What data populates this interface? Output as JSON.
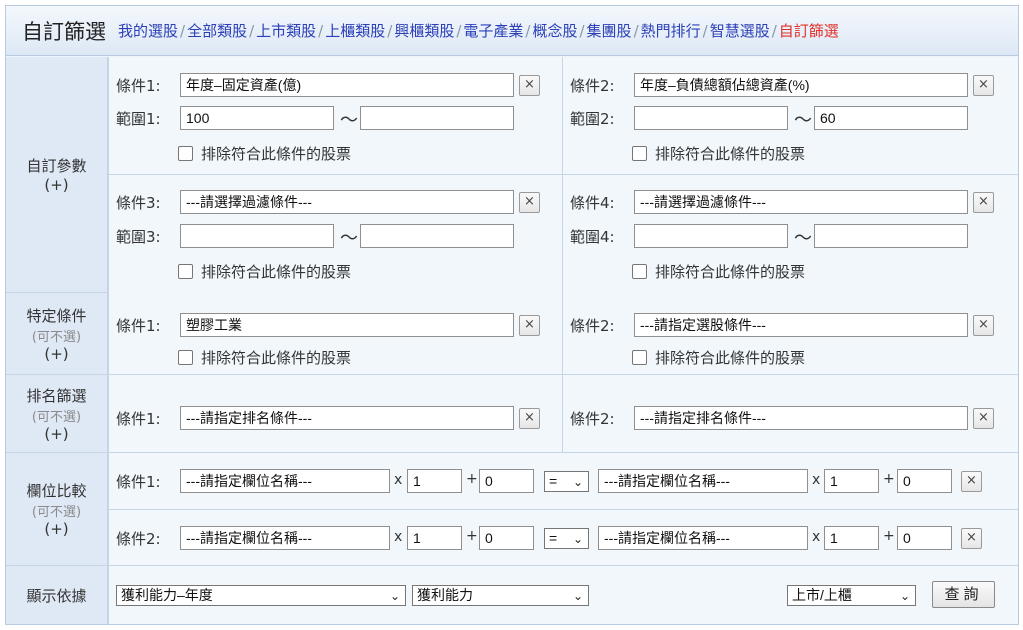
{
  "header": {
    "title": "自訂篩選",
    "nav": [
      "我的選股",
      "全部類股",
      "上市類股",
      "上櫃類股",
      "興櫃類股",
      "電子產業",
      "概念股",
      "集團股",
      "熱門排行",
      "智慧選股",
      "自訂篩選"
    ],
    "active": "自訂篩選",
    "separator": "/"
  },
  "custom": {
    "label": "自訂參數",
    "plus": "(+)",
    "exclude_text": "排除符合此條件的股票",
    "c1": {
      "label": "條件1:",
      "value": "年度–固定資產(億)",
      "range_label": "範圍1:",
      "min": "100",
      "max": ""
    },
    "c2": {
      "label": "條件2:",
      "value": "年度–負債總額佔總資產(%)",
      "range_label": "範圍2:",
      "min": "",
      "max": "60"
    },
    "c3": {
      "label": "條件3:",
      "value": "---請選擇過濾條件---",
      "range_label": "範圍3:",
      "min": "",
      "max": ""
    },
    "c4": {
      "label": "條件4:",
      "value": "---請選擇過濾條件---",
      "range_label": "範圍4:",
      "min": "",
      "max": ""
    },
    "tilde": "～"
  },
  "specific": {
    "label": "特定條件",
    "optional": "(可不選)",
    "plus": "(+)",
    "c1": {
      "label": "條件1:",
      "value": "塑膠工業"
    },
    "c2": {
      "label": "條件2:",
      "value": "---請指定選股條件---"
    }
  },
  "ranking": {
    "label": "排名篩選",
    "optional": "(可不選)",
    "plus": "(+)",
    "c1": {
      "label": "條件1:",
      "value": "---請指定排名條件---"
    },
    "c2": {
      "label": "條件2:",
      "value": "---請指定排名條件---"
    }
  },
  "compare": {
    "label": "欄位比較",
    "optional": "(可不選)",
    "plus": "(+)",
    "rows": [
      {
        "label": "條件1:",
        "left_field": "---請指定欄位名稱---",
        "left_mult": "1",
        "left_add": "0",
        "op": "=",
        "right_field": "---請指定欄位名稱---",
        "right_mult": "1",
        "right_add": "0"
      },
      {
        "label": "條件2:",
        "left_field": "---請指定欄位名稱---",
        "left_mult": "1",
        "left_add": "0",
        "op": "=",
        "right_field": "---請指定欄位名稱---",
        "right_mult": "1",
        "right_add": "0"
      }
    ],
    "x": "x",
    "plus_sign": "+"
  },
  "display": {
    "label": "顯示依據",
    "select1": "獲利能力–年度",
    "select2": "獲利能力",
    "market": "上市/上櫃",
    "query": "查詢"
  },
  "close_glyph": "×"
}
